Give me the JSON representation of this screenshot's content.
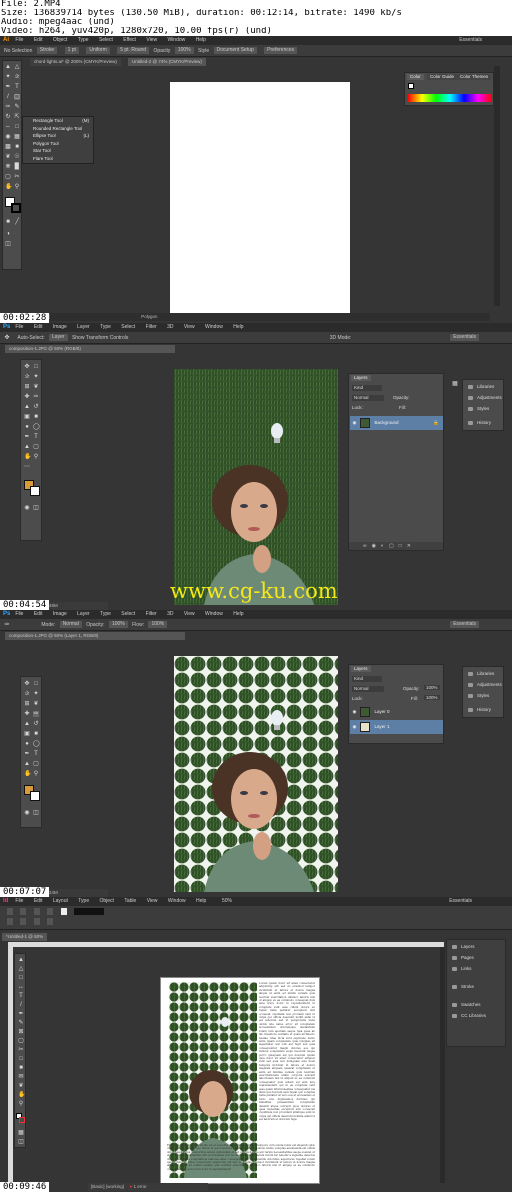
{
  "header": {
    "file": "File: 2.MP4",
    "size": "Size: 136839714 bytes (130.50 MiB), duration: 00:12:14, bitrate: 1490 kb/s",
    "audio": "Audio: mpeg4aac (und)",
    "video": "Video: h264, yuv420p, 1280x720, 10.00 fps(r) (und)"
  },
  "frames": [
    {
      "timestamp": "00:02:28",
      "app": "Ai",
      "menu": [
        "File",
        "Edit",
        "Object",
        "Type",
        "Select",
        "Effect",
        "View",
        "Window",
        "Help"
      ],
      "workspace": "Essentials",
      "options": [
        "No Selection",
        "Stroke",
        "1 pt",
        "Uniform",
        "5 pt. Round",
        "Opacity",
        "100%",
        "Style",
        "Document Setup",
        "Preferences"
      ],
      "tabs": [
        "chord-lights.ai* @ 200% (CMYK/Preview)",
        "Untitled-2 @ 74% (CMYK/Preview)"
      ],
      "flyout": [
        {
          "label": "Rectangle Tool",
          "key": "(M)"
        },
        {
          "label": "Rounded Rectangle Tool",
          "key": ""
        },
        {
          "label": "Ellipse Tool",
          "key": "(L)"
        },
        {
          "label": "Polygon Tool",
          "key": ""
        },
        {
          "label": "Star Tool",
          "key": ""
        },
        {
          "label": "Flare Tool",
          "key": ""
        }
      ],
      "color_panel_tabs": [
        "Color",
        "Color Guide",
        "Color Themes"
      ],
      "status": [
        "74%",
        "Polygon"
      ]
    },
    {
      "timestamp": "00:04:54",
      "app": "Ps",
      "menu": [
        "File",
        "Edit",
        "Image",
        "Layer",
        "Type",
        "Select",
        "Filter",
        "3D",
        "View",
        "Window",
        "Help"
      ],
      "workspace": "Essentials",
      "options": [
        "Auto-Select:",
        "Layer",
        "Show Transform Controls",
        "3D Mode:"
      ],
      "tab": "composition-1.JPG @ 50% (RGB/8)",
      "layers_panel": {
        "title": "Layers",
        "kind": "Kind",
        "blend": "Normal",
        "opacity_label": "Opacity:",
        "fill_label": "Fill:",
        "lock_label": "Lock:",
        "layers": [
          "Background"
        ]
      },
      "right_panel": [
        "Libraries",
        "Adjustments",
        "Styles",
        "History"
      ],
      "status": "Doc: 1.48M/1.48M",
      "watermark": "www.cg-ku.com"
    },
    {
      "timestamp": "00:07:07",
      "app": "Ps",
      "menu": [
        "File",
        "Edit",
        "Image",
        "Layer",
        "Type",
        "Select",
        "Filter",
        "3D",
        "View",
        "Window",
        "Help"
      ],
      "workspace": "Essentials",
      "options": [
        "Mode:",
        "Normal",
        "Opacity:",
        "100%",
        "Flow:",
        "100%"
      ],
      "tab": "composition-1.JPG @ 50% (Layer 1, RGB/8)",
      "layers_panel": {
        "title": "Layers",
        "kind": "Kind",
        "blend": "Normal",
        "opacity_label": "Opacity:",
        "opacity": "100%",
        "fill_label": "Fill:",
        "fill": "100%",
        "lock_label": "Lock:",
        "layers": [
          "Layer 0",
          "Layer 1"
        ]
      },
      "right_panel": [
        "Libraries",
        "Adjustments",
        "Styles",
        "History"
      ],
      "status": "Doc: 1.48M/3.24M"
    },
    {
      "timestamp": "00:09:46",
      "app": "Id",
      "menu": [
        "File",
        "Edit",
        "Layout",
        "Type",
        "Object",
        "Table",
        "View",
        "Window",
        "Help"
      ],
      "zoom": "50%",
      "workspace": "Essentials",
      "tab": "*Untitled-1 @ 50%",
      "right_panel": [
        "Layers",
        "Pages",
        "Links",
        "Stroke",
        "Swatches",
        "CC Libraries"
      ],
      "status": [
        "[Basic] (working)",
        "1 error"
      ]
    }
  ],
  "colors": {
    "app_bg": "#353535",
    "ps_blue": "#31a8ff",
    "ai_orange": "#ff9a00",
    "id_pink": "#ff3366",
    "selected_layer": "#5d7fa6",
    "foreground_swatch": "#d99a3a",
    "watermark": "#f5e81a"
  }
}
